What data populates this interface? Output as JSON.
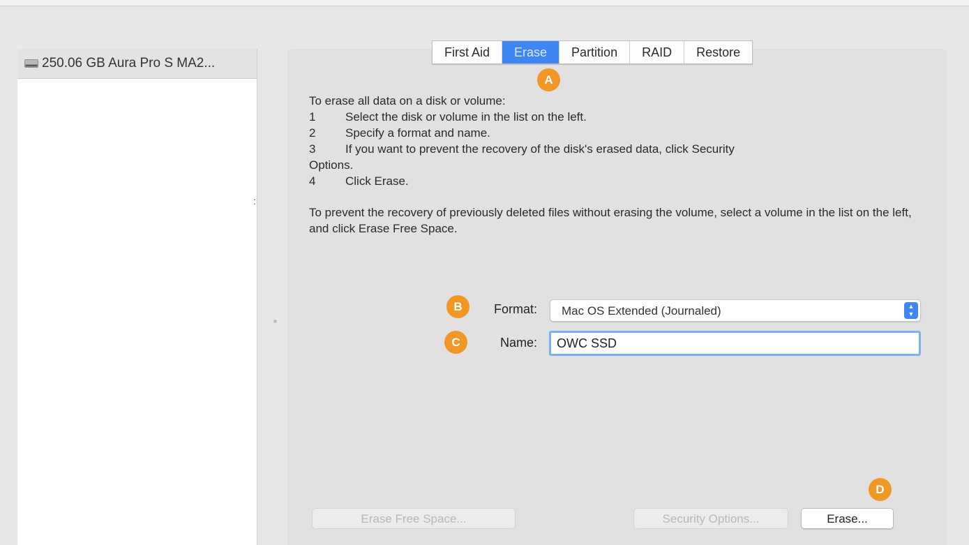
{
  "sidebar": {
    "disk_label": "250.06 GB Aura Pro S MA2...",
    "disk_icon": "internal-drive-icon"
  },
  "tabs": [
    {
      "label": "First Aid",
      "active": false
    },
    {
      "label": "Erase",
      "active": true
    },
    {
      "label": "Partition",
      "active": false
    },
    {
      "label": "RAID",
      "active": false
    },
    {
      "label": "Restore",
      "active": false
    }
  ],
  "instructions": {
    "intro": "To erase all data on a disk or volume:",
    "steps": [
      {
        "num": "1",
        "text": "Select the disk or volume in the list on the left."
      },
      {
        "num": "2",
        "text": "Specify a format and name."
      },
      {
        "num": "3",
        "text": "If you want to prevent the recovery of the disk's erased data, click Security"
      },
      {
        "num": "",
        "text": "Options."
      },
      {
        "num": "4",
        "text": "Click Erase."
      }
    ],
    "paragraph2": "To prevent the recovery of previously deleted files without erasing the volume, select a volume in the list on the left, and click Erase Free Space."
  },
  "form": {
    "format_label": "Format:",
    "format_value": "Mac OS Extended (Journaled)",
    "name_label": "Name:",
    "name_value": "OWC SSD"
  },
  "buttons": {
    "erase_free_space": "Erase Free Space...",
    "security_options": "Security Options...",
    "erase": "Erase..."
  },
  "badges": {
    "a": "A",
    "b": "B",
    "c": "C",
    "d": "D"
  },
  "colors": {
    "accent": "#3d86f3",
    "badge": "#f09725"
  }
}
